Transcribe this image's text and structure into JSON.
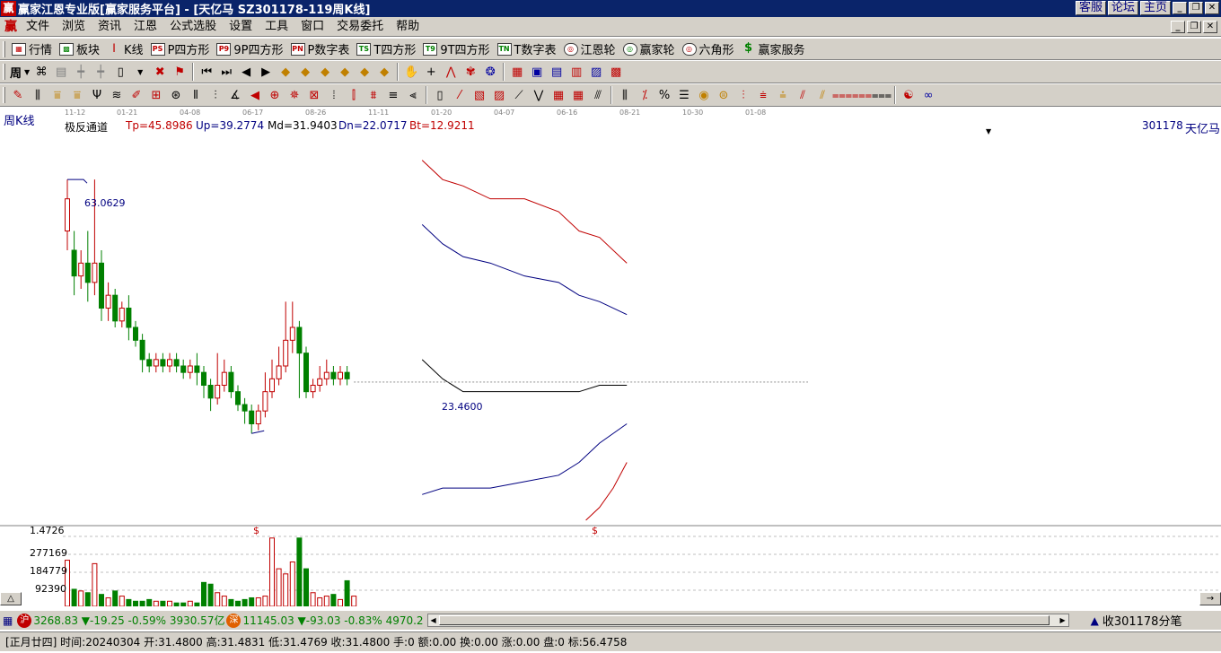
{
  "window": {
    "title": "赢家江恩专业版[赢家服务平台] - [天亿马  SZ301178-119周K线]",
    "logo": "赢",
    "links": [
      "客服",
      "论坛",
      "主页"
    ]
  },
  "menu": {
    "logo": "赢",
    "items": [
      "文件",
      "浏览",
      "资讯",
      "江恩",
      "公式选股",
      "设置",
      "工具",
      "窗口",
      "交易委托",
      "帮助"
    ]
  },
  "toolbar1": {
    "items": [
      {
        "icon": "grid-icon",
        "label": "行情"
      },
      {
        "icon": "blocks-icon",
        "label": "板块"
      },
      {
        "icon": "candle-icon",
        "label": "K线"
      },
      {
        "icon": "ps-icon",
        "glyph": "PS",
        "label": "P四方形"
      },
      {
        "icon": "p9-icon",
        "glyph": "P9",
        "label": "9P四方形"
      },
      {
        "icon": "pn-icon",
        "glyph": "PN",
        "label": "P数字表"
      },
      {
        "icon": "ts-icon",
        "glyph": "TS",
        "label": "T四方形"
      },
      {
        "icon": "t9-icon",
        "glyph": "T9",
        "label": "9T四方形"
      },
      {
        "icon": "tn-icon",
        "glyph": "TN",
        "label": "T数字表"
      },
      {
        "icon": "gann-wheel-icon",
        "glyph": "◎",
        "label": "江恩轮"
      },
      {
        "icon": "winner-wheel-icon",
        "glyph": "◎",
        "label": "赢家轮"
      },
      {
        "icon": "hexagon-icon",
        "glyph": "◎",
        "label": "六角形"
      },
      {
        "icon": "dollar-icon",
        "glyph": "$",
        "label": "赢家服务"
      }
    ]
  },
  "toolbar2": {
    "period": "周"
  },
  "chart_header": {
    "period_label": "周K线",
    "indicator": "极反通道",
    "tp": "Tp=45.8986",
    "up": "Up=39.2774",
    "md": "Md=31.9403",
    "dn": "Dn=22.0717",
    "bt": "Bt=12.9211",
    "code": "301178",
    "name": "天亿马",
    "high_label": "63.0629",
    "low_label": "23.4600",
    "date_ticks": [
      "11-12",
      "01-21",
      "04-08",
      "06-17",
      "08-26",
      "11-11",
      "01-20",
      "04-07",
      "06-16",
      "08-21",
      "10-30",
      "01-08"
    ]
  },
  "volume": {
    "scale": [
      "1.4726",
      "277169",
      "184779",
      "92390"
    ],
    "marker": "$"
  },
  "status1": {
    "sh_badge": "沪",
    "sh_value": "3268.83",
    "sh_change": "▼-19.25",
    "sh_pct": "-0.59%",
    "sh_amount": "3930.57亿",
    "sz_badge": "深",
    "sz_value": "11145.03",
    "sz_change": "▼-93.03",
    "sz_pct": "-0.83%",
    "sz_amount": "4970.2",
    "tick": "收301178分笔"
  },
  "status2": {
    "text": "[正月廿四] 时间:20240304 开:31.4800 高:31.4831 低:31.4769 收:31.4800 手:0 额:0.00 换:0.00 涨:0.00 盘:0 标:56.4758"
  },
  "colors": {
    "up": "#c00000",
    "down": "#008000",
    "channel_outer": "#c00000",
    "channel_inner": "#000080",
    "mid": "#000000",
    "title_bg": "#0a246a"
  },
  "chart_data": {
    "type": "candlestick",
    "title": "",
    "ylim": [
      10,
      70
    ],
    "series": [
      {
        "name": "Tp",
        "values": [
          [
            20,
            66
          ],
          [
            23,
            63
          ],
          [
            26,
            62
          ],
          [
            30,
            60
          ],
          [
            35,
            60
          ],
          [
            40,
            58
          ],
          [
            43,
            55
          ],
          [
            46,
            54
          ],
          [
            50,
            50
          ]
        ]
      },
      {
        "name": "Up",
        "values": [
          [
            20,
            56
          ],
          [
            23,
            53
          ],
          [
            26,
            51
          ],
          [
            30,
            50
          ],
          [
            35,
            48
          ],
          [
            40,
            47
          ],
          [
            43,
            45
          ],
          [
            46,
            44
          ],
          [
            50,
            42
          ]
        ]
      },
      {
        "name": "Md",
        "values": [
          [
            20,
            35
          ],
          [
            23,
            32
          ],
          [
            26,
            30
          ],
          [
            30,
            30
          ],
          [
            35,
            30
          ],
          [
            40,
            30
          ],
          [
            43,
            30
          ],
          [
            46,
            31
          ],
          [
            50,
            31
          ]
        ]
      },
      {
        "name": "Dn",
        "values": [
          [
            20,
            14
          ],
          [
            23,
            15
          ],
          [
            26,
            15
          ],
          [
            30,
            15
          ],
          [
            35,
            16
          ],
          [
            40,
            17
          ],
          [
            43,
            19
          ],
          [
            46,
            22
          ],
          [
            50,
            25
          ]
        ]
      },
      {
        "name": "Bt",
        "values": [
          [
            44,
            10
          ],
          [
            46,
            12
          ],
          [
            48,
            15
          ],
          [
            50,
            19
          ]
        ]
      }
    ],
    "candles": [
      [
        55,
        60,
        52,
        63
      ],
      [
        52,
        48,
        45,
        55
      ],
      [
        48,
        50,
        46,
        52
      ],
      [
        50,
        47,
        44,
        55
      ],
      [
        47,
        50,
        45,
        63
      ],
      [
        50,
        43,
        41,
        52
      ],
      [
        43,
        45,
        41,
        47
      ],
      [
        45,
        41,
        40,
        46
      ],
      [
        41,
        43,
        40,
        44
      ],
      [
        43,
        40,
        38,
        45
      ],
      [
        40,
        38,
        37,
        41
      ],
      [
        38,
        35,
        33,
        39
      ],
      [
        35,
        34,
        33,
        36
      ],
      [
        34,
        35,
        33,
        36
      ],
      [
        35,
        34,
        33,
        36
      ],
      [
        34,
        35,
        33,
        36
      ],
      [
        35,
        34,
        33,
        36
      ],
      [
        34,
        33,
        32,
        35
      ],
      [
        33,
        34,
        32,
        35
      ],
      [
        34,
        33,
        31,
        36
      ],
      [
        33,
        31,
        29,
        34
      ],
      [
        31,
        29,
        27,
        32
      ],
      [
        29,
        31,
        28,
        36
      ],
      [
        31,
        33,
        30,
        35
      ],
      [
        33,
        30,
        29,
        34
      ],
      [
        30,
        28,
        27,
        31
      ],
      [
        28,
        27,
        25,
        29
      ],
      [
        27,
        25,
        23.5,
        28
      ],
      [
        25,
        27,
        24,
        28
      ],
      [
        27,
        30,
        26,
        33
      ],
      [
        30,
        32,
        29,
        35
      ],
      [
        32,
        34,
        31,
        37
      ],
      [
        34,
        38,
        33,
        44
      ],
      [
        38,
        40,
        36,
        44
      ],
      [
        40,
        36,
        29,
        41
      ],
      [
        36,
        30,
        29,
        37
      ],
      [
        30,
        31,
        29,
        32
      ],
      [
        31,
        32,
        30,
        34
      ],
      [
        32,
        33,
        31,
        35
      ],
      [
        33,
        32,
        31,
        34
      ],
      [
        32,
        33,
        31,
        34
      ],
      [
        33,
        32,
        31,
        34
      ]
    ],
    "volumes": [
      27,
      10,
      9,
      8,
      25,
      7,
      5,
      9,
      6,
      4,
      3,
      3,
      4,
      3,
      3,
      3,
      2,
      2,
      3,
      2,
      14,
      13,
      8,
      6,
      4,
      3,
      4,
      5,
      5,
      6,
      40,
      22,
      19,
      26,
      40,
      22,
      8,
      5,
      6,
      7,
      4,
      15,
      6
    ]
  }
}
